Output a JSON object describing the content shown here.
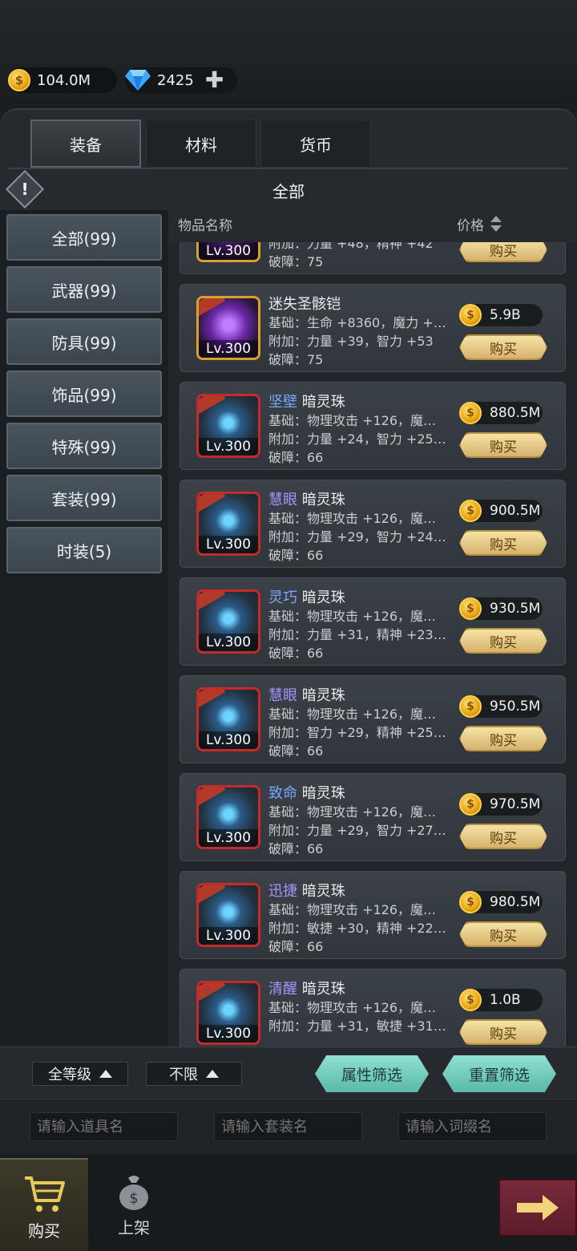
{
  "currency": {
    "gold": "104.0M",
    "gems": "2425"
  },
  "tabs": [
    "装备",
    "材料",
    "货币"
  ],
  "filter_title": "全部",
  "categories": [
    "全部(99)",
    "武器(99)",
    "防具(99)",
    "饰品(99)",
    "特殊(99)",
    "套装(99)",
    "时装(5)"
  ],
  "list_header": {
    "name": "物品名称",
    "price": "价格"
  },
  "items": [
    {
      "level": "Lv.300",
      "affix": "",
      "name": "",
      "base": "附加：力量 +48，精神 +42",
      "extra": "",
      "break": "破障：75",
      "price": "",
      "buy": "购买"
    },
    {
      "level": "Lv.300",
      "affix": "",
      "name": "迷失圣骸铠",
      "base": "基础：生命 +8360，魔力 +…",
      "extra": "附加：力量 +39，智力 +53",
      "break": "破障：75",
      "price": "5.9B",
      "buy": "购买"
    },
    {
      "level": "Lv.300",
      "affix": "坚壁",
      "name": "暗灵珠",
      "base": "基础：物理攻击 +126，魔…",
      "extra": "附加：力量 +24，智力 +25…",
      "break": "破障：66",
      "price": "880.5M",
      "buy": "购买"
    },
    {
      "level": "Lv.300",
      "affix": "慧眼",
      "name": "暗灵珠",
      "base": "基础：物理攻击 +126，魔…",
      "extra": "附加：力量 +29，智力 +24…",
      "break": "破障：66",
      "price": "900.5M",
      "buy": "购买"
    },
    {
      "level": "Lv.300",
      "affix": "灵巧",
      "name": "暗灵珠",
      "base": "基础：物理攻击 +126，魔…",
      "extra": "附加：力量 +31，精神 +23…",
      "break": "破障：66",
      "price": "930.5M",
      "buy": "购买"
    },
    {
      "level": "Lv.300",
      "affix": "慧眼",
      "name": "暗灵珠",
      "base": "基础：物理攻击 +126，魔…",
      "extra": "附加：智力 +29，精神 +25…",
      "break": "破障：66",
      "price": "950.5M",
      "buy": "购买"
    },
    {
      "level": "Lv.300",
      "affix": "致命",
      "name": "暗灵珠",
      "base": "基础：物理攻击 +126，魔…",
      "extra": "附加：力量 +29，智力 +27…",
      "break": "破障：66",
      "price": "970.5M",
      "buy": "购买"
    },
    {
      "level": "Lv.300",
      "affix": "迅捷",
      "name": "暗灵珠",
      "base": "基础：物理攻击 +126，魔…",
      "extra": "附加：敏捷 +30，精神 +22…",
      "break": "破障：66",
      "price": "980.5M",
      "buy": "购买"
    },
    {
      "level": "Lv.300",
      "affix": "清醒",
      "name": "暗灵珠",
      "base": "基础：物理攻击 +126，魔…",
      "extra": "附加：力量 +31，敏捷 +31…",
      "break": "",
      "price": "1.0B",
      "buy": "购买"
    }
  ],
  "filters": {
    "level": "全等级",
    "limit": "不限",
    "attr_filter": "属性筛选",
    "reset_filter": "重置筛选"
  },
  "inputs": {
    "item_placeholder": "请输入道具名",
    "set_placeholder": "请输入套装名",
    "affix_placeholder": "请输入词缀名"
  },
  "nav": {
    "buy": "购买",
    "sell": "上架"
  }
}
